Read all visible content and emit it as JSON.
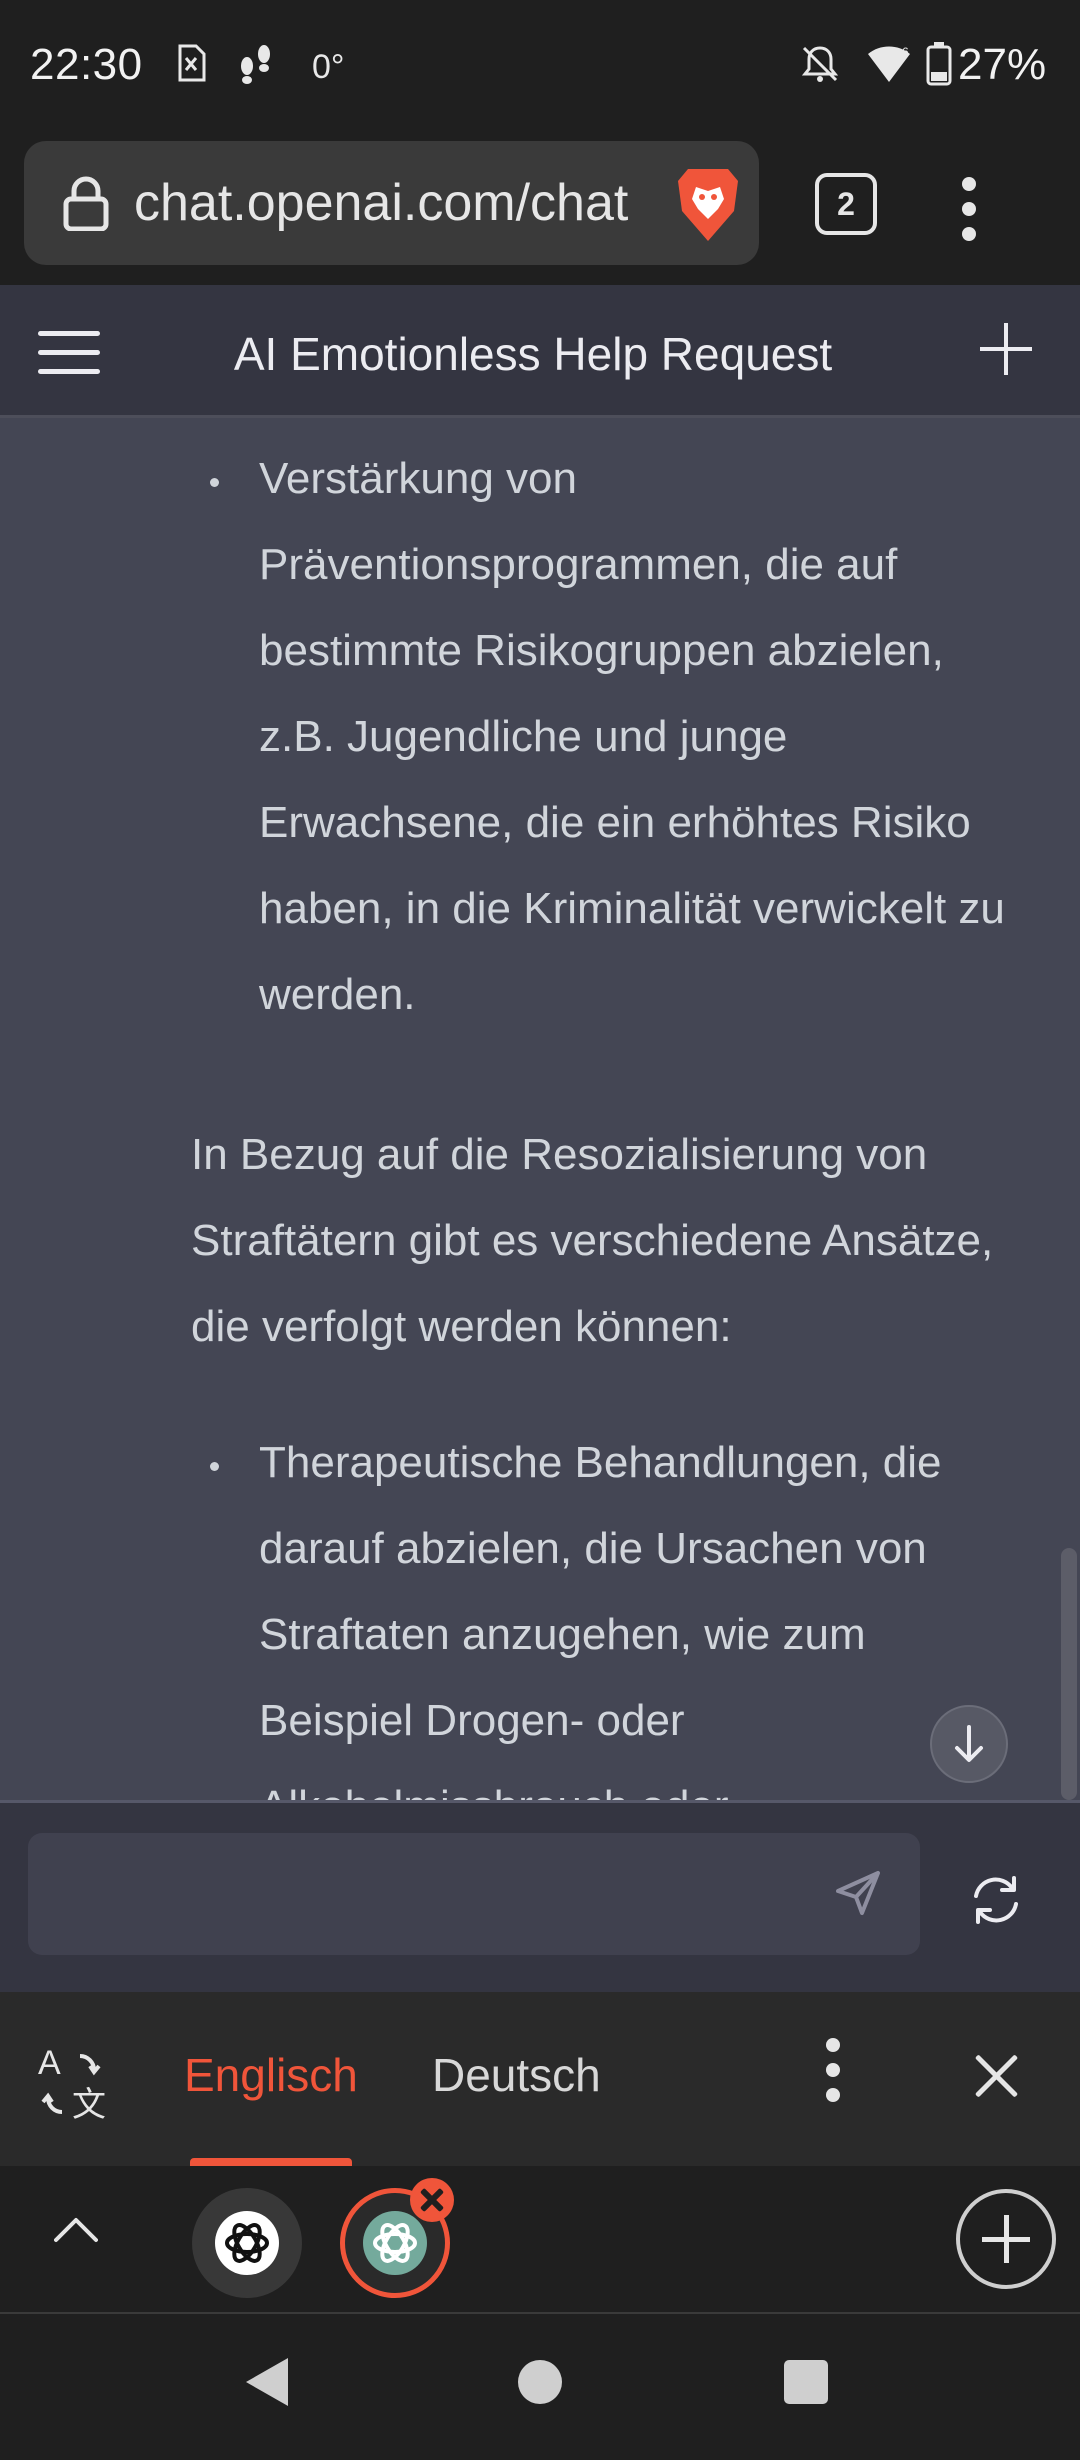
{
  "status_bar": {
    "time": "22:30",
    "temperature": "0°",
    "battery": "27%"
  },
  "browser": {
    "url": "chat.openai.com/chat",
    "tab_count": "2"
  },
  "chat": {
    "title": "AI Emotionless Help Request",
    "bullets_top": [
      "Verstärkung von Präventionsprogrammen, die auf bestimmte Risikogruppen abzielen, z.B. Jugendliche und junge Erwachsene, die ein erhöhtes Risiko haben, in die Kriminalität verwickelt zu werden."
    ],
    "paragraph": "In Bezug auf die Resozialisierung von Straftätern gibt es verschiedene Ansätze, die verfolgt werden können:",
    "bullets_bottom": [
      "Therapeutische Behandlungen, die darauf abzielen, die Ursachen von Straftaten anzugehen, wie zum Beispiel Drogen- oder Alkoholmissbrauch oder"
    ],
    "input_value": ""
  },
  "translate_bar": {
    "source_language": "Englisch",
    "target_language": "Deutsch",
    "active": "Englisch"
  },
  "colors": {
    "accent": "#f0553a",
    "chat_bg": "#444654",
    "header_bg": "#343541",
    "chrome_bg": "#1f1f1f"
  }
}
